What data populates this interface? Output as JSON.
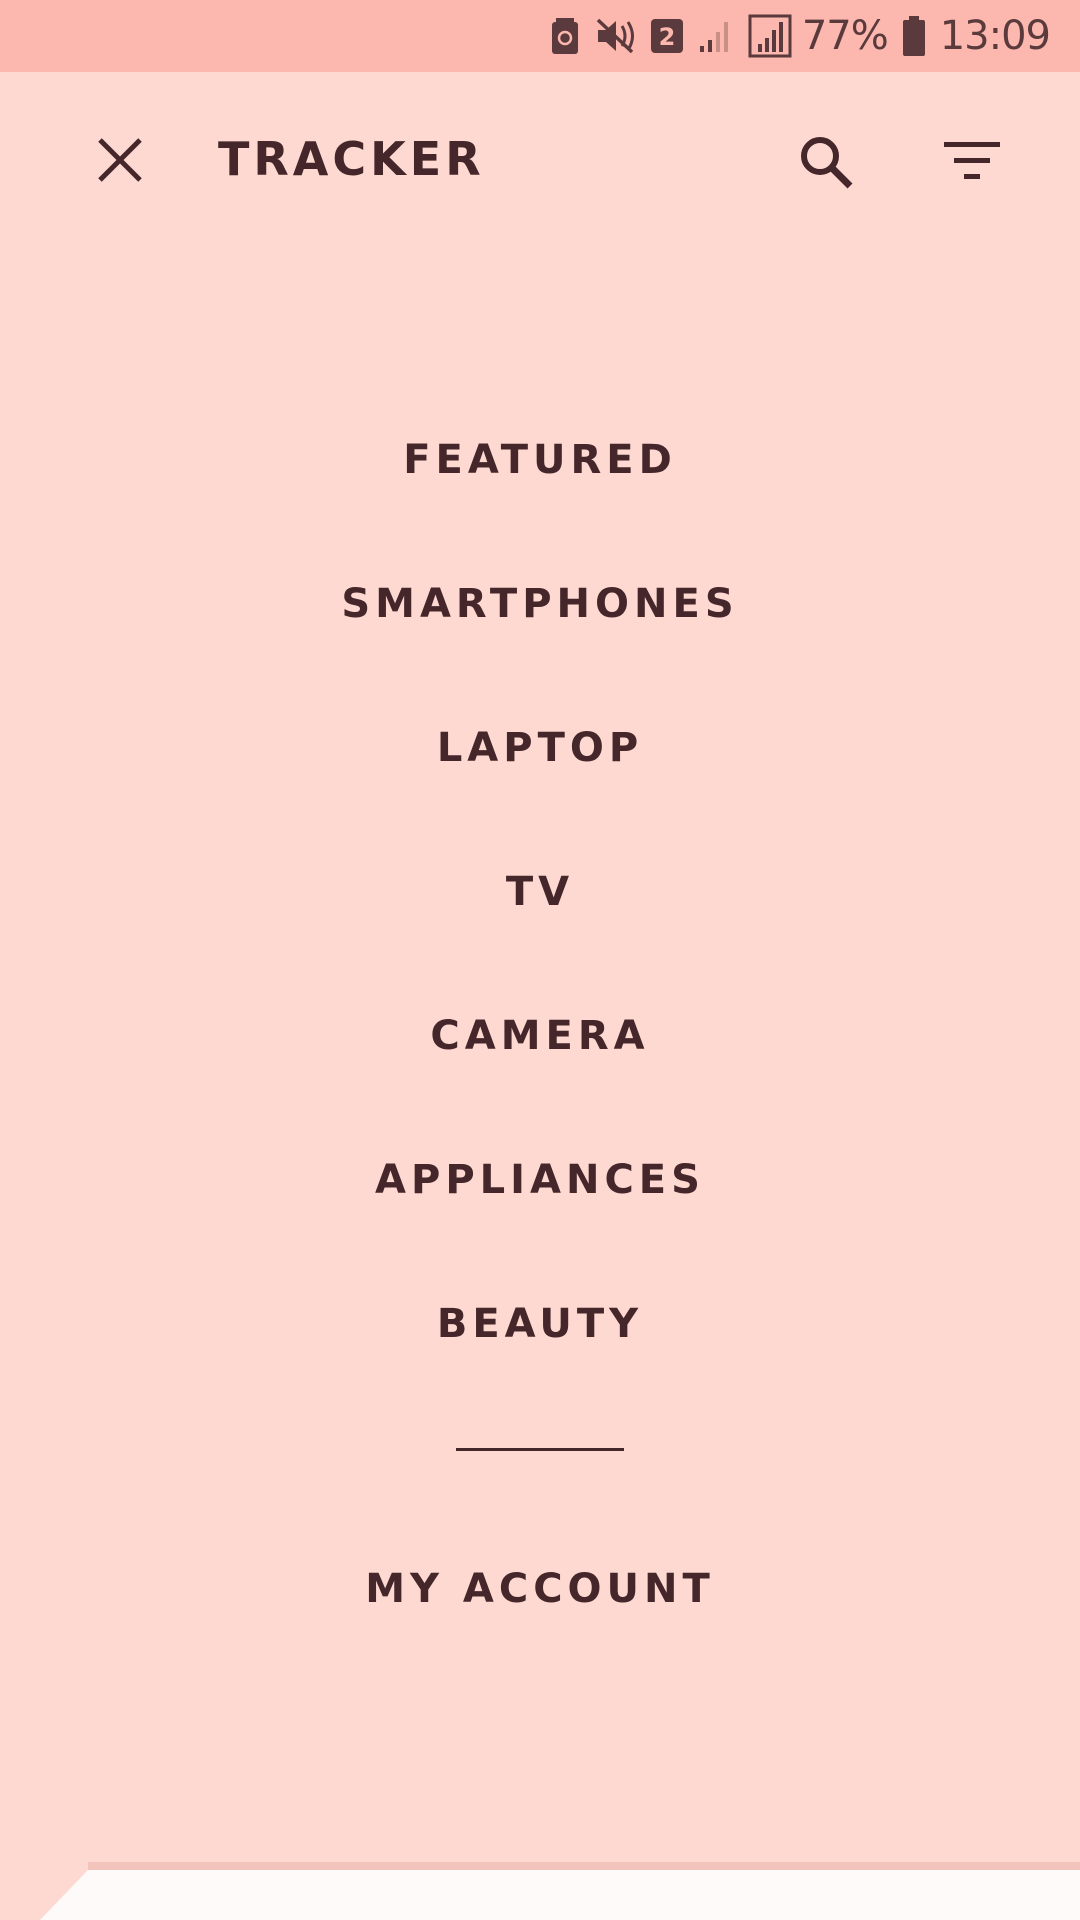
{
  "status_bar": {
    "battery_percent": "77%",
    "time": "13:09",
    "sim_badge": "2",
    "icons": [
      "battery-saver-icon",
      "mute-icon",
      "sim-2-icon",
      "signal-weak-icon",
      "signal-strong-icon",
      "battery-icon"
    ]
  },
  "toolbar": {
    "title": "TRACKER",
    "close_icon": "close-icon",
    "search_icon": "search-icon",
    "filter_icon": "filter-icon"
  },
  "menu": {
    "items": [
      {
        "label": "FEATURED"
      },
      {
        "label": "SMARTPHONES"
      },
      {
        "label": "LAPTOP"
      },
      {
        "label": "TV"
      },
      {
        "label": "CAMERA"
      },
      {
        "label": "APPLIANCES"
      },
      {
        "label": "BEAUTY"
      }
    ],
    "account_label": "MY ACCOUNT"
  },
  "colors": {
    "status_bar_bg": "#fcb8ae",
    "background": "#fdd9d1",
    "text": "#45272b",
    "sheet": "#fffafa"
  }
}
